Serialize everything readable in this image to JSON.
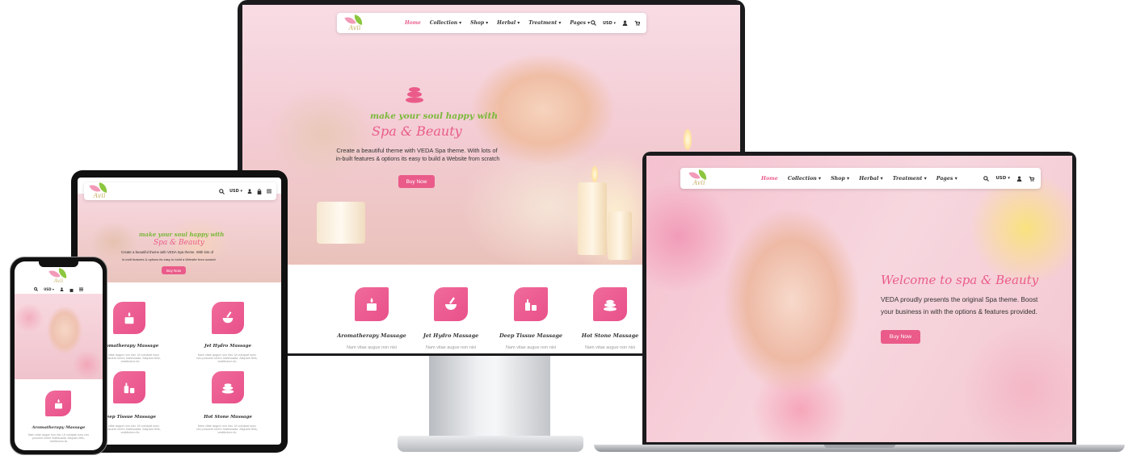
{
  "brand": {
    "logo_word": "Avii"
  },
  "nav": {
    "items": [
      "Home",
      "Collection ▾",
      "Shop ▾",
      "Herbal ▾",
      "Treatment ▾",
      "Pages ▾"
    ],
    "currency": "USD ▾",
    "currency_short": "USD"
  },
  "desktop": {
    "hero_script": "make your soul happy with",
    "hero_title": "Spa & Beauty",
    "hero_text_1": "Create a beautiful theme with VEDA Spa theme. With lots of",
    "hero_text_2": "in-built features & options its easy to build a Website from scratch",
    "button": "Buy Now",
    "services": [
      {
        "title": "Aromatherapy Massage",
        "text": "Nam vitae augue non nisi"
      },
      {
        "title": "Jet Hydro Massage",
        "text": "Nam vitae augue non nisi"
      },
      {
        "title": "Deep Tissue Massage",
        "text": "Nam vitae augue non nisi"
      },
      {
        "title": "Hot Stone Massage",
        "text": "Nam vitae augue non nisi"
      }
    ]
  },
  "laptop": {
    "hero_title": "Welcome to spa & Beauty",
    "hero_text_1": "VEDA proudly presents the original Spa theme. Boost",
    "hero_text_2": "your business in with the options & features provided.",
    "button": "Buy Now"
  },
  "tablet": {
    "hero_script": "make your soul happy with",
    "hero_title": "Spa & Beauty",
    "hero_text_1": "Create a beautiful theme with VEDA Spa theme. With lots of",
    "hero_text_2": "in-built features & options its easy to build a Website from scratch",
    "button": "Buy Now",
    "services": [
      {
        "title": "Aromatherapy Massage",
        "text": "Nam vitae augue non nisi. Ut volutpat nunc nec posuere lorem malesuada. Aliquam felis, vestibulum ilo"
      },
      {
        "title": "Jet Hydro Massage",
        "text": "Nam vitae augue non nisi. Ut volutpat nunc nec posuere lorem malesuada. Aliquam felis, vestibulum ilo"
      },
      {
        "title": "Deep Tissue Massage",
        "text": "Nam vitae augue non nisi. Ut volutpat nunc nec posuere lorem malesuada. Aliquam felis, vestibulum ilo"
      },
      {
        "title": "Hot Stone Massage",
        "text": "Nam vitae augue non nisi. Ut volutpat nunc nec posuere lorem malesuada. Aliquam felis, vestibulum ilo"
      }
    ]
  },
  "phone": {
    "service_title": "Aromatherapy Massage",
    "service_text": "Nam vitae augue non nisi. Ut volutpat nunc nec posuere lorem malesuada. Aliquam felis, vestibulum ilo"
  },
  "colors": {
    "accent": "#ea5b8a",
    "leaf_green": "#8cc63f",
    "leaf_pink": "#f29ab8"
  },
  "icons": [
    "search-icon",
    "user-icon",
    "bag-icon",
    "menu-icon",
    "candle-icon",
    "mortar-icon",
    "bottle-icon",
    "stones-icon"
  ]
}
